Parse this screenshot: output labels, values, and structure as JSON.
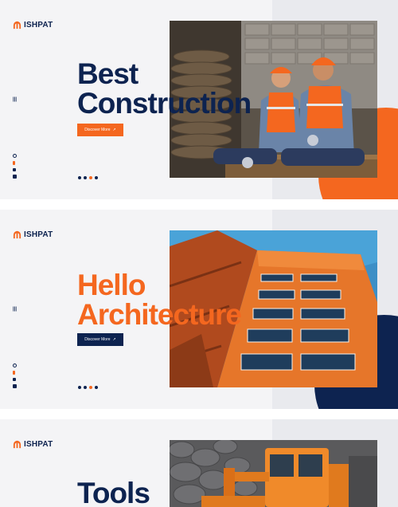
{
  "brand": {
    "name": "ISHPAT"
  },
  "colors": {
    "orange": "#f4671f",
    "navy": "#0d2350",
    "light": "#f4f4f6"
  },
  "slides": [
    {
      "headline_line1": "Best",
      "headline_line2": "Construction",
      "headline_color": "#0d2350",
      "cta_label": "Discover More",
      "cta_color": "#f4671f",
      "photo_subject": "two construction workers in hard hats sitting on stacked wood",
      "blob_color": "#f4671f"
    },
    {
      "headline_line1": "Hello",
      "headline_line2": "Architecture",
      "headline_color": "#f4671f",
      "cta_label": "Discover More",
      "cta_color": "#0d2350",
      "photo_subject": "orange high-rise building against blue sky",
      "blob_color": "#0d2350"
    },
    {
      "headline_line1": "Tools",
      "headline_color": "#0d2350",
      "photo_subject": "orange excavator near stone wall"
    }
  ],
  "social_icons": [
    "youtube-icon",
    "tiktok-icon",
    "vimeo-icon",
    "facebook-icon"
  ],
  "slider_dots": 4
}
